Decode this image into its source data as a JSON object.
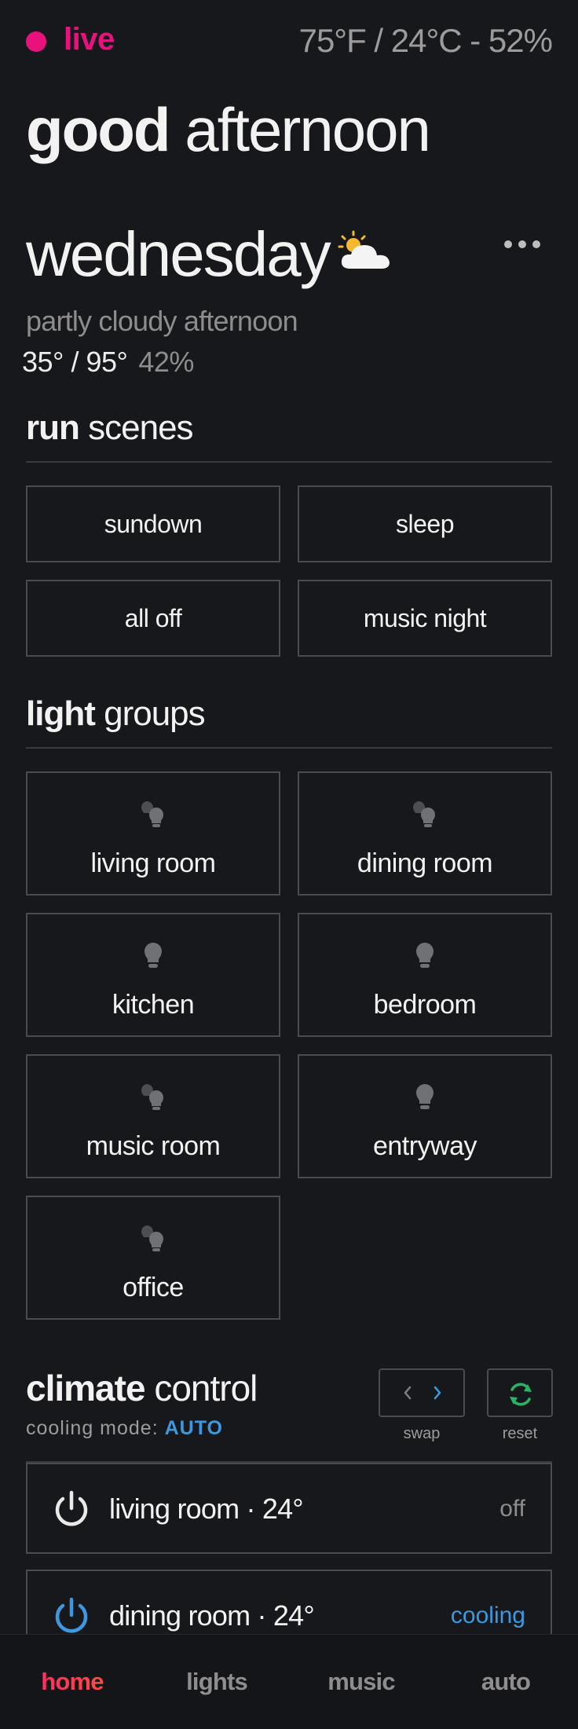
{
  "status": {
    "live_label": "live",
    "weather_summary": "75°F / 24°C - 52%"
  },
  "greeting": {
    "bold": "good",
    "rest": "afternoon"
  },
  "weather": {
    "day": "wednesday",
    "icon": "partly-cloudy-icon",
    "condition": "partly cloudy afternoon",
    "temp_range": "35° / 95°",
    "humidity": "42%"
  },
  "scenes": {
    "title_bold": "run",
    "title_rest": "scenes",
    "items": [
      {
        "label": "sundown"
      },
      {
        "label": "sleep"
      },
      {
        "label": "all off"
      },
      {
        "label": "music night"
      }
    ]
  },
  "light_groups": {
    "title_bold": "light",
    "title_rest": "groups",
    "items": [
      {
        "label": "living room",
        "icon": "bulb-group-icon"
      },
      {
        "label": "dining room",
        "icon": "bulb-group-icon"
      },
      {
        "label": "kitchen",
        "icon": "bulb-icon"
      },
      {
        "label": "bedroom",
        "icon": "bulb-icon"
      },
      {
        "label": "music room",
        "icon": "bulb-group-icon"
      },
      {
        "label": "entryway",
        "icon": "bulb-icon"
      },
      {
        "label": "office",
        "icon": "bulb-group-icon"
      }
    ]
  },
  "climate": {
    "title_bold": "climate",
    "title_rest": "control",
    "mode_label": "cooling mode:",
    "mode_value": "AUTO",
    "swap_label": "swap",
    "reset_label": "reset",
    "rooms": [
      {
        "name": "living room · 24°",
        "status": "off",
        "status_color": "#8e8e8e",
        "power_color": "#e9e9e9"
      },
      {
        "name": "dining room · 24°",
        "status": "cooling",
        "status_color": "#3d98e0",
        "power_color": "#3d98e0"
      }
    ]
  },
  "nav": {
    "items": [
      {
        "label": "home",
        "active": true
      },
      {
        "label": "lights",
        "active": false
      },
      {
        "label": "music",
        "active": false
      },
      {
        "label": "auto",
        "active": false
      }
    ]
  },
  "colors": {
    "background": "#17181b",
    "accent_pink": "#e8127f",
    "accent_blue": "#3d98e0",
    "reset_green": "#28b463",
    "border": "#4a4b4f"
  }
}
